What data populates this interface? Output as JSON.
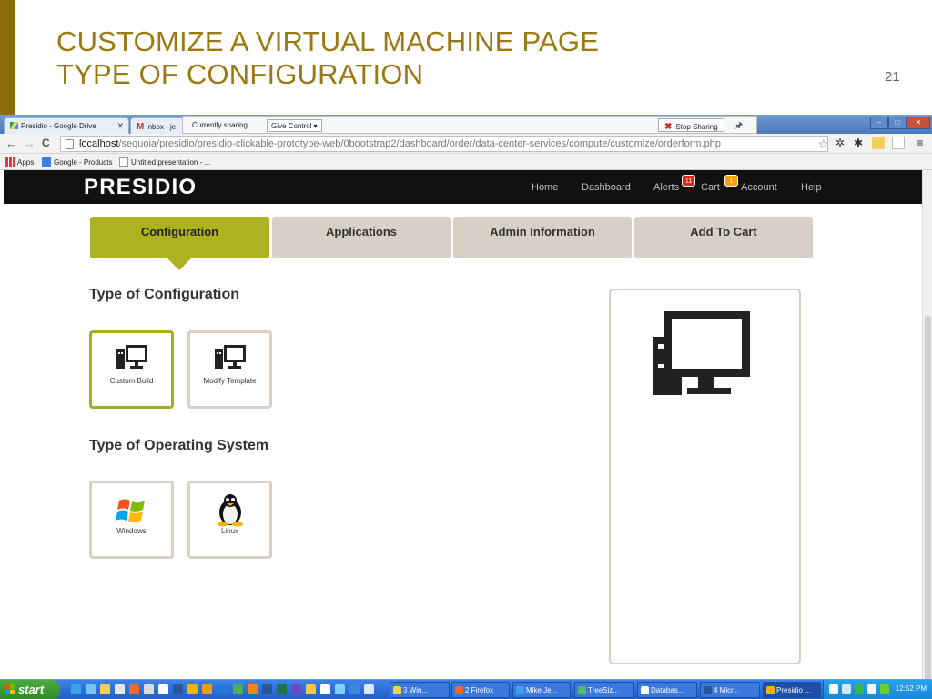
{
  "slide": {
    "title_line1": "CUSTOMIZE A VIRTUAL MACHINE PAGE",
    "title_line2": "TYPE OF CONFIGURATION",
    "number": "21"
  },
  "browser": {
    "tabs": [
      {
        "label": "Presidio - Google Drive"
      },
      {
        "label": "Inbox - je"
      }
    ],
    "sharing": {
      "label": "Currently sharing",
      "give_control": "Give Control ▾",
      "stop_sharing": "Stop Sharing"
    },
    "url": {
      "host": "localhost",
      "path": "/sequoia/presidio/presidio-clickable-prototype-web/0bootstrap2/dashboard/order/data-center-services/compute/customize/orderform.php"
    },
    "bookmarks": [
      {
        "label": "Apps"
      },
      {
        "label": "Google - Products"
      },
      {
        "label": "Untitled presentation - ..."
      }
    ]
  },
  "app": {
    "logo": "PRESIDIO",
    "nav": {
      "home": "Home",
      "dashboard": "Dashboard",
      "alerts": "Alerts",
      "alerts_count": "11",
      "cart": "Cart",
      "cart_count": "1",
      "account": "Account",
      "help": "Help"
    },
    "wizard_tabs": [
      {
        "label": "Configuration",
        "active": true
      },
      {
        "label": "Applications",
        "active": false
      },
      {
        "label": "Admin Information",
        "active": false
      },
      {
        "label": "Add To Cart",
        "active": false
      }
    ],
    "config_section": {
      "title": "Type of Configuration",
      "options": [
        {
          "label": "Custom Build",
          "icon": "computer-icon",
          "selected": true
        },
        {
          "label": "Modify Template",
          "icon": "computer-icon",
          "selected": false
        }
      ]
    },
    "os_section": {
      "title": "Type of Operating System",
      "options": [
        {
          "label": "Windows",
          "icon": "windows-logo-icon"
        },
        {
          "label": "Linux",
          "icon": "linux-tux-icon"
        }
      ]
    },
    "preview_icon": "computer-icon",
    "colors": {
      "accent": "#acb220",
      "tab_inactive": "#d8cfc6",
      "header": "#111111",
      "slide_title": "#9a7a10"
    }
  },
  "taskbar": {
    "start": "start",
    "tasks": [
      {
        "label": "3 Win..."
      },
      {
        "label": "2 Firefox"
      },
      {
        "label": "Mike Je..."
      },
      {
        "label": "TreeSiz..."
      },
      {
        "label": "Databas..."
      },
      {
        "label": "4 Micr..."
      },
      {
        "label": "Presidio ..."
      }
    ],
    "clock": "12:52 PM"
  }
}
